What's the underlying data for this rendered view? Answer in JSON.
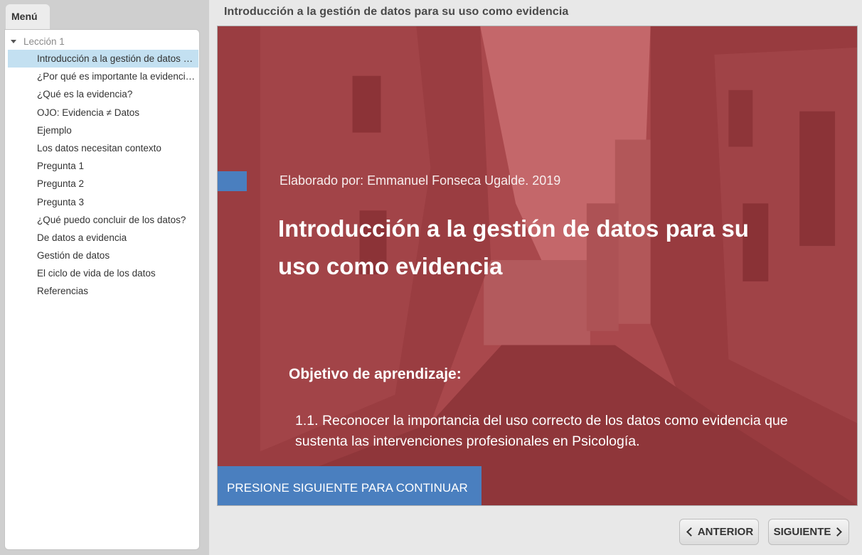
{
  "sidebar": {
    "menu_tab_label": "Menú",
    "lesson_label": "Lección 1",
    "items": [
      {
        "label": "Introducción a la gestión de datos para su uso como evidencia",
        "active": true
      },
      {
        "label": "¿Por qué es importante la evidencia?",
        "active": false
      },
      {
        "label": "¿Qué es la evidencia?",
        "active": false
      },
      {
        "label": "OJO: Evidencia ≠ Datos",
        "active": false
      },
      {
        "label": "Ejemplo",
        "active": false
      },
      {
        "label": "Los datos necesitan contexto",
        "active": false
      },
      {
        "label": "Pregunta 1",
        "active": false
      },
      {
        "label": "Pregunta 2",
        "active": false
      },
      {
        "label": "Pregunta 3",
        "active": false
      },
      {
        "label": "¿Qué puedo concluir de los datos?",
        "active": false
      },
      {
        "label": "De datos a evidencia",
        "active": false
      },
      {
        "label": "Gestión de datos",
        "active": false
      },
      {
        "label": "El ciclo de vida de los datos",
        "active": false
      },
      {
        "label": "Referencias",
        "active": false
      }
    ]
  },
  "main": {
    "page_title": "Introducción a la gestión de datos para su uso como evidencia",
    "slide": {
      "author": "Elaborado por: Emmanuel Fonseca Ugalde. 2019",
      "title": "Introducción a la gestión de datos para su uso como evidencia",
      "objective_heading": "Objetivo de aprendizaje:",
      "objective_text": "1.1. Reconocer la importancia del uso correcto de los datos como evidencia que sustenta las intervenciones profesionales en Psicología.",
      "continue_label": "PRESIONE SIGUIENTE PARA CONTINUAR"
    },
    "nav": {
      "prev_label": "ANTERIOR",
      "next_label": "SIGUIENTE"
    }
  },
  "colors": {
    "slide_overlay": "#a9484c",
    "accent_blue": "#4a7fbf",
    "active_item_bg": "#c3e0f1"
  }
}
